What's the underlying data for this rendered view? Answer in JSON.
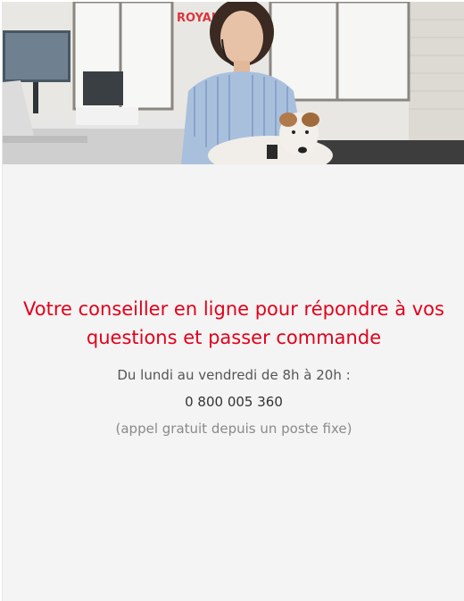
{
  "hero": {
    "brand_text": "ROYAL C"
  },
  "contact": {
    "headline": "Votre conseiller en ligne pour répondre à vos questions et passer commande",
    "hours": "Du lundi au vendredi de 8h à 20h :",
    "phone": "0 800 005 360",
    "note": "(appel gratuit depuis un poste fixe)"
  },
  "colors": {
    "headline": "#e2001a",
    "background": "#f4f4f4"
  }
}
